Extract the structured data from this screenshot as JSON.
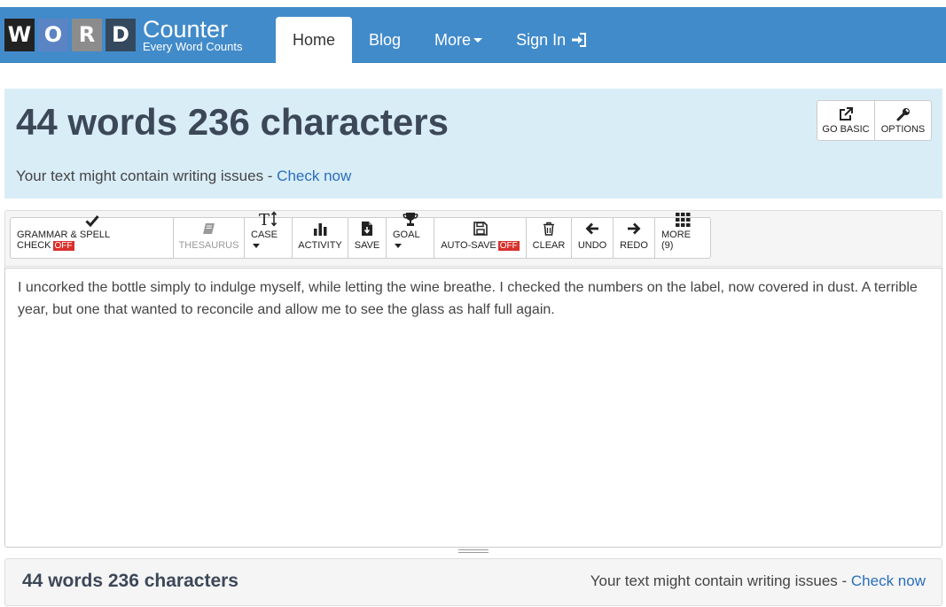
{
  "logo": {
    "letters": [
      "W",
      "O",
      "R",
      "D"
    ],
    "brand": "Counter",
    "tagline": "Every Word Counts"
  },
  "nav": {
    "home": "Home",
    "blog": "Blog",
    "more": "More",
    "sign_in": "Sign In"
  },
  "stats": {
    "count_text": "44 words 236 characters",
    "issue_prefix": "Your text might contain writing issues - ",
    "issue_link": "Check now"
  },
  "options": {
    "go_basic": "GO BASIC",
    "options": "OPTIONS"
  },
  "toolbar": {
    "grammar": "GRAMMAR & SPELL CHECK",
    "grammar_badge": "OFF",
    "thesaurus": "THESAURUS",
    "case": "CASE",
    "activity": "ACTIVITY",
    "save": "SAVE",
    "goal": "GOAL",
    "autosave": "AUTO-SAVE",
    "autosave_badge": "OFF",
    "clear": "CLEAR",
    "undo": "UNDO",
    "redo": "REDO",
    "more": "MORE (9)"
  },
  "editor": {
    "text": "I uncorked the bottle simply to indulge myself, while letting the wine breathe. I checked the numbers on the label, now covered in dust. A terrible year, but one that wanted to reconcile and allow me to see the glass as half full again."
  },
  "footer": {
    "count_text": "44 words 236 characters",
    "issue_prefix": "Your text might contain writing issues - ",
    "issue_link": "Check now"
  },
  "colors": {
    "navbar": "#428bca",
    "stats_bg": "#d9edf7",
    "badge_off": "#d9302c",
    "link": "#2a6ebd"
  }
}
